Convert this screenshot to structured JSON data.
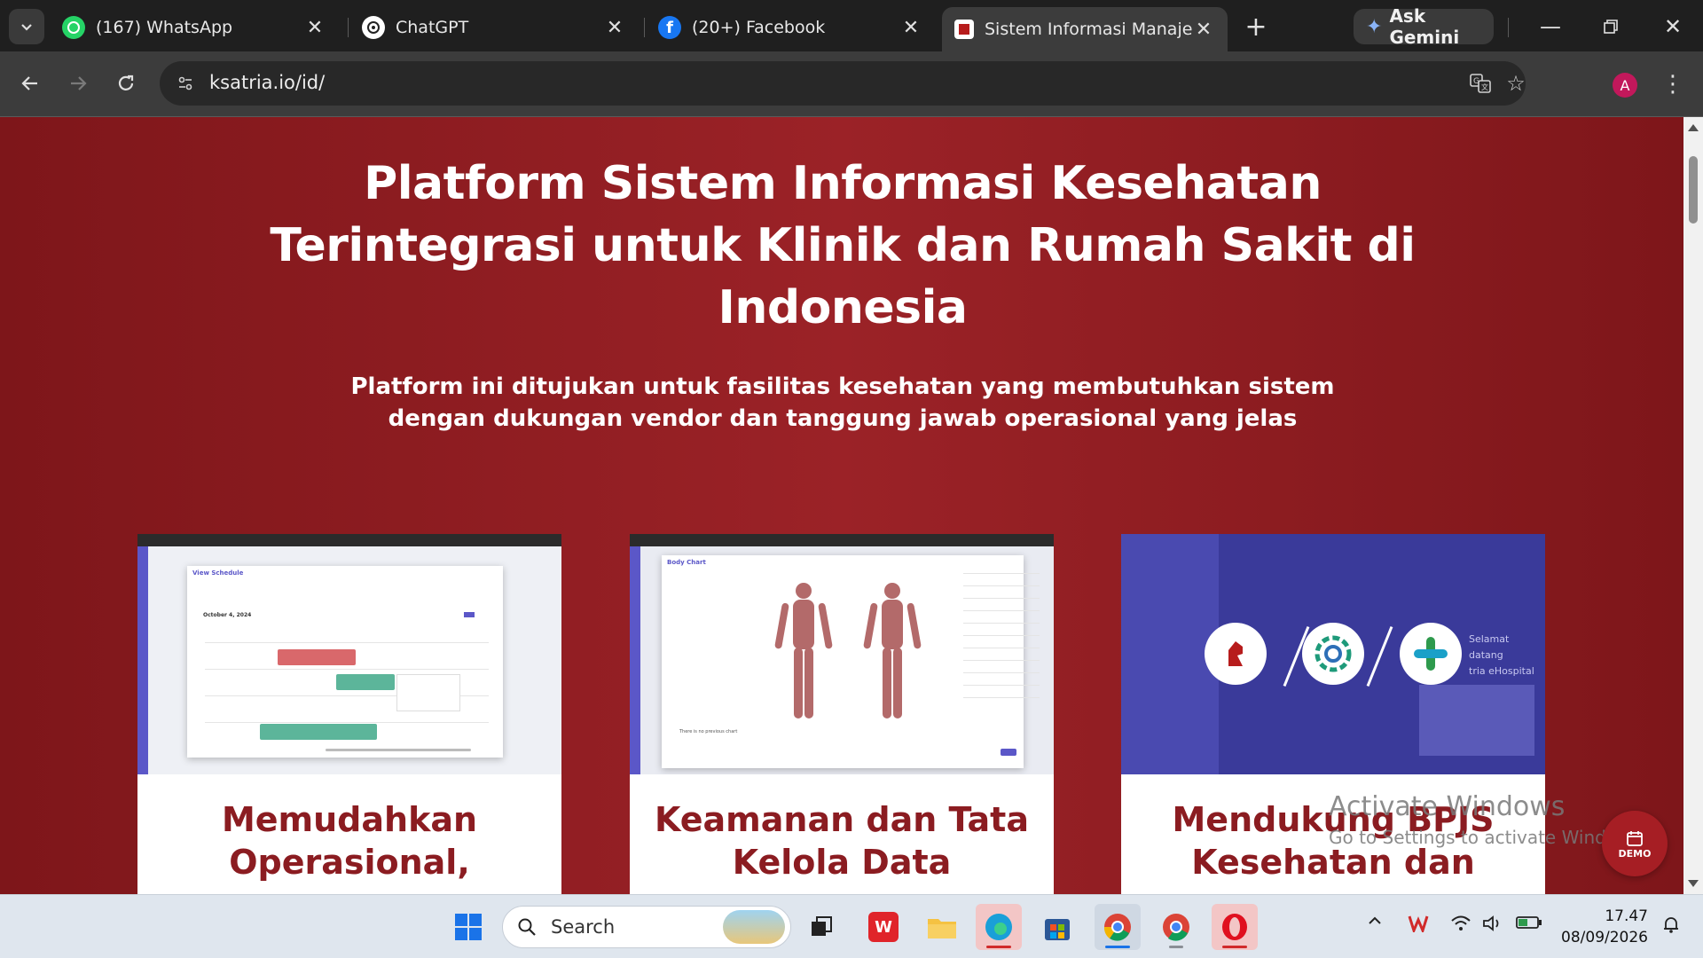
{
  "browser": {
    "tabs": [
      {
        "title": "(167) WhatsApp",
        "icon": "whatsapp-icon"
      },
      {
        "title": "ChatGPT",
        "icon": "chatgpt-icon"
      },
      {
        "title": "(20+) Facebook",
        "icon": "facebook-icon"
      },
      {
        "title": "Sistem Informasi Manajemen",
        "icon": "ksatria-icon",
        "active": true
      }
    ],
    "ask_gemini": "Ask Gemini",
    "url": "ksatria.io/id/",
    "profile_initial": "A"
  },
  "page": {
    "hero_title": "Platform Sistem Informasi Kesehatan Terintegrasi untuk Klinik dan Rumah Sakit di Indonesia",
    "hero_subtitle_line1": "Platform ini ditujukan untuk fasilitas kesehatan yang membutuhkan sistem",
    "hero_subtitle_line2": "dengan dukungan vendor dan tanggung jawab operasional yang jelas",
    "cards": [
      {
        "title": "Memudahkan Operasional,",
        "shot": {
          "modal_title": "View Schedule",
          "date": "October 4, 2024"
        }
      },
      {
        "title": "Keamanan dan Tata Kelola Data",
        "shot": {
          "modal_title": "Body Chart",
          "empty_note": "There is no previous chart"
        }
      },
      {
        "title": "Mendukung BPJS Kesehatan dan",
        "shot": {
          "welcome_line1": "Selamat datang",
          "welcome_line2": "tria eHospital"
        }
      }
    ],
    "demo_button": "DEMO",
    "watermark_line1": "Activate Windows",
    "watermark_line2": "Go to Settings to activate Windows."
  },
  "taskbar": {
    "search_placeholder": "Search",
    "time": "17.47",
    "date": "08/09/2026"
  },
  "colors": {
    "hero_bg": "#9b2227",
    "card_title": "#8b1c21",
    "accent_purple": "#5b57c8"
  }
}
